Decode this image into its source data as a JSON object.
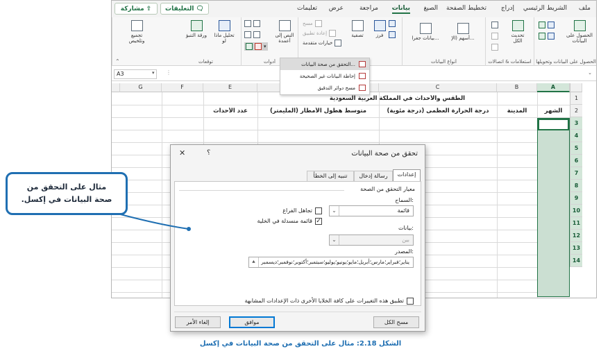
{
  "menubar": {
    "tabs": [
      "ملف",
      "الشريط الرئيسي",
      "إدراج",
      "تخطيط الصفحة",
      "الصيغ",
      "بيانات",
      "مراجعة",
      "عرض",
      "تعليمات"
    ],
    "active_tab": "بيانات",
    "comments_label": "التعليقات",
    "share_label": "مشاركة"
  },
  "ribbon": {
    "get_data_label": "الحصول على البيانات",
    "refresh_all_label": "تحديث الكل",
    "stocks_label": "أسهم (الإ...",
    "geography_label": "بيانات جغرا...",
    "sort_label": "فرز",
    "filter_label": "تصفية",
    "clear_label": "مسح",
    "reapply_label": "إعادة تطبيق",
    "advanced_label": "خيارات متقدمة",
    "text_to_columns_label": "النص إلى أعمدة",
    "what_if_label": "تحليل ماذا لو",
    "forecast_label": "ورقة التنبؤ",
    "outline_label": "تجميع وتلخيص",
    "groups": {
      "get_transform": "الحصول على البيانات وتحويلها",
      "queries": "استعلامات & اتصالات",
      "data_types": "أنواع البيانات",
      "sort_filter": "فرز وتصفية",
      "data_tools": "أدوات",
      "forecast": "توقعات"
    }
  },
  "dv_menu": {
    "items": [
      "التحقق من صحة البيانات...",
      "إحاطة البيانات غير الصحيحة",
      "مسح دوائر التدقيق"
    ]
  },
  "formula_bar": {
    "name_box": "A3"
  },
  "sheet": {
    "columns": [
      "A",
      "B",
      "C",
      "D",
      "E",
      "F",
      "G"
    ],
    "selected_column": "A",
    "rows": [
      "1",
      "2",
      "3",
      "4",
      "5",
      "6",
      "7",
      "8",
      "9",
      "10",
      "11",
      "12",
      "13",
      "14"
    ],
    "title": "الطقس والأحداث في المملكة العربية السعودية",
    "headers": {
      "a": "الشهر",
      "b": "المدينة",
      "c": "درجة الحرارة العظمى (درجة مئوية)",
      "d": "متوسط هطول الأمطار (المليمتر)",
      "e": "عدد الأحداث"
    }
  },
  "dialog": {
    "title": "تحقق من صحة البيانات",
    "help": "؟",
    "close": "✕",
    "tabs": [
      "إعدادات",
      "رسالة إدخال",
      "تنبيه إلى الخطأ"
    ],
    "criteria_label": "معيار التحقق من الصحة",
    "allow_label": "السماح:",
    "allow_value": "قائمة",
    "ignore_blank_label": "تجاهل الفراغ",
    "in_cell_dropdown_label": "قائمة منسدلة في الخلية",
    "data_label": "بيانات:",
    "data_value": "بين",
    "source_label": "المصدر:",
    "source_value": "يناير؛فبراير؛مارس؛أبريل؛مايو؛يونيو؛يوليو؛سبتمبر؛أكتوبر؛نوفمبر؛ديسمبر",
    "apply_all_label": "تطبيق هذه التغييرات على كافة الخلايا الأخرى ذات الإعدادات المشابهة",
    "clear_all_label": "مسح الكل",
    "ok_label": "موافق",
    "cancel_label": "إلغاء الأمر"
  },
  "callout": {
    "line1": "مثال على التحقق من",
    "line2": "صحة البيانات في إكسل."
  },
  "caption": "الشكل 2.18: مثال على التحقق من صحة البيانات في إكسل"
}
